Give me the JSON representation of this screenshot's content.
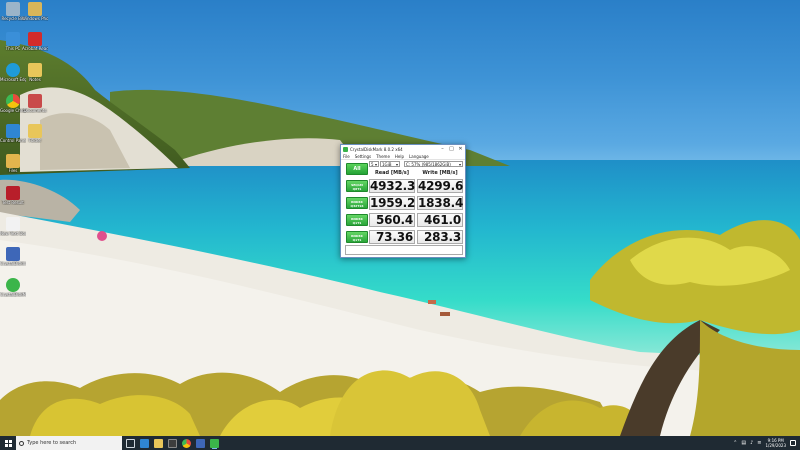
{
  "desktop": {
    "icons": [
      {
        "label": "Recycle Bin",
        "color": "#9bb4c9"
      },
      {
        "label": "Windows Photo Viewer",
        "color": "#d9b65a"
      },
      {
        "label": "This PC",
        "color": "#3a8fd8"
      },
      {
        "label": "Acrobat Reader",
        "color": "#d22b2b"
      },
      {
        "label": "Microsoft Edge",
        "color": "#1f9bd8"
      },
      {
        "label": "Notes",
        "color": "#e8c65a"
      },
      {
        "label": "Google Chrome",
        "color": "#e94b3c"
      },
      {
        "label": "Documents",
        "color": "#c94a4a"
      },
      {
        "label": "Control Panel",
        "color": "#2f86d3"
      },
      {
        "label": "Folder",
        "color": "#e8c65a"
      },
      {
        "label": "Files",
        "color": "#e2b54d"
      },
      {
        "label": "Test Result",
        "color": "#b81e2a"
      },
      {
        "label": "New Text Document",
        "color": "#f2f2f2"
      },
      {
        "label": "CrystalDiskInfo",
        "color": "#3e67b8"
      },
      {
        "label": "CrystalDiskMark 8",
        "color": "#3bb54a"
      }
    ]
  },
  "window": {
    "title": "CrystalDiskMark 8.0.2 x64",
    "menu": [
      "File",
      "Settings",
      "Theme",
      "Help",
      "Language"
    ],
    "all_button": "All",
    "count": "5",
    "size": "1GiB",
    "drive": "C: 57% (985/1862GiB)",
    "read_header": "Read [MB/s]",
    "write_header": "Write [MB/s]",
    "rows": [
      {
        "line1": "SEQ1M",
        "line2": "Q8T1",
        "read": "4932.3",
        "write": "4299.6"
      },
      {
        "line1": "RND4K",
        "line2": "Q32T16",
        "read": "1959.2",
        "write": "1838.4"
      },
      {
        "line1": "RND4K",
        "line2": "Q1T1",
        "read": "560.4",
        "write": "461.0"
      },
      {
        "line1": "RND4K",
        "line2": "Q1T1",
        "read": "73.36",
        "write": "283.3"
      }
    ]
  },
  "taskbar": {
    "search_placeholder": "Type here to search",
    "time": "9:16 PM",
    "date": "1/29/2023",
    "tray_icons": [
      "chevron-up",
      "network",
      "volume",
      "language"
    ]
  }
}
